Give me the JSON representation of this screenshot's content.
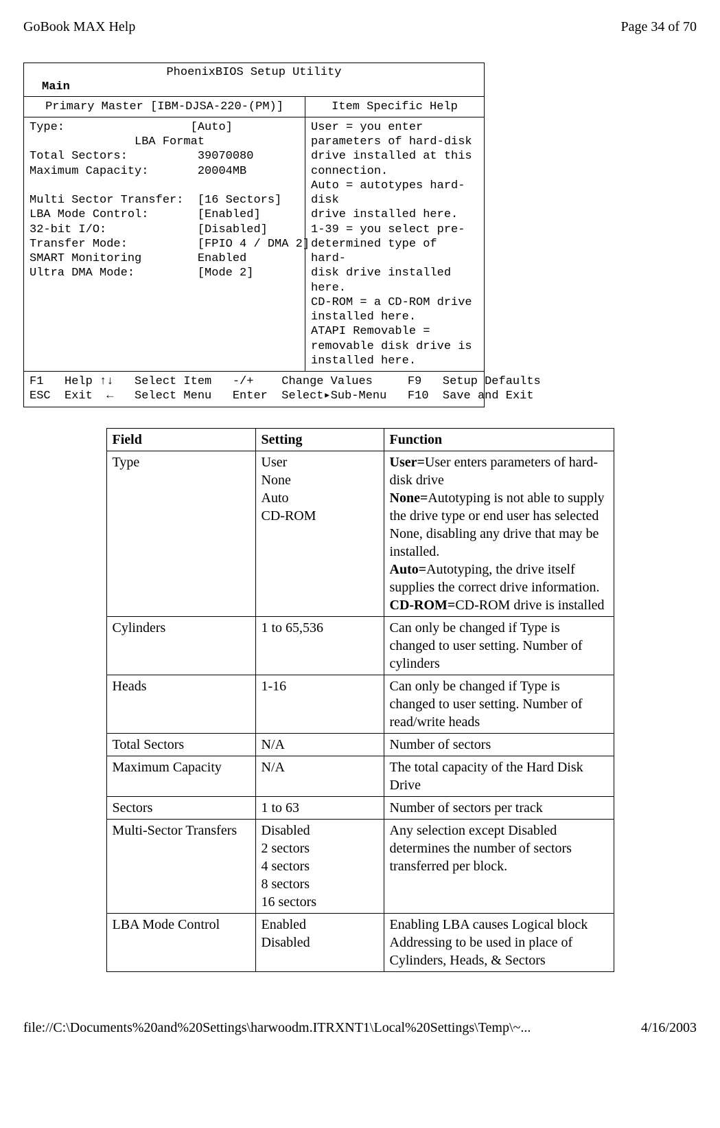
{
  "header": {
    "left": "GoBook MAX Help",
    "right": "Page 34 of 70"
  },
  "bios": {
    "title": "PhoenixBIOS Setup Utility",
    "main_label": "Main",
    "sub_left": "Primary Master [IBM-DJSA-220-(PM)]",
    "sub_right": "Item Specific Help",
    "body_left": "Type:                  [Auto]\n               LBA Format\nTotal Sectors:          39070080\nMaximum Capacity:       20004MB\n\nMulti Sector Transfer:  [16 Sectors]\nLBA Mode Control:       [Enabled]\n32-bit I/O:             [Disabled]\nTransfer Mode:          [FPIO 4 / DMA 2]\nSMART Monitoring        Enabled\nUltra DMA Mode:         [Mode 2]\n\n\n\n",
    "body_right": "User = you enter\nparameters of hard-disk\ndrive installed at this\nconnection.\nAuto = autotypes hard-disk\ndrive installed here.\n1-39 = you select pre-\ndetermined type of hard-\ndisk drive installed here.\nCD-ROM = a CD-ROM drive\ninstalled here.\nATAPI Removable =\nremovable disk drive is\ninstalled here.",
    "footer": "F1   Help ↑↓   Select Item   -/+    Change Values     F9   Setup Defaults\nESC  Exit  ←   Select Menu   Enter  Select▸Sub-Menu   F10  Save and Exit"
  },
  "table": {
    "headers": {
      "field": "Field",
      "setting": "Setting",
      "function": "Function"
    },
    "rows": [
      {
        "field": "Type",
        "setting": "User\nNone\nAuto\nCD-ROM",
        "func_parts": [
          {
            "b": "User="
          },
          {
            "t": "User enters parameters of hard-disk drive"
          },
          {
            "br": true
          },
          {
            "b": "None="
          },
          {
            "t": "Autotyping is not able to supply the drive type or end user has selected None, disabling any drive that may be installed."
          },
          {
            "br": true
          },
          {
            "b": "Auto="
          },
          {
            "t": "Autotyping, the drive itself supplies the correct drive information."
          },
          {
            "br": true
          },
          {
            "b": "CD-ROM="
          },
          {
            "t": "CD-ROM drive is installed"
          }
        ]
      },
      {
        "field": "Cylinders",
        "setting": "1 to 65,536",
        "function": "Can only be changed if Type is changed to user setting.  Number of cylinders"
      },
      {
        "field": "Heads",
        "setting": "1-16",
        "function": "Can only be changed if Type is changed to user setting. Number of read/write heads"
      },
      {
        "field": "Total Sectors",
        "setting": "N/A",
        "function": "Number of sectors"
      },
      {
        "field": "Maximum Capacity",
        "setting": "N/A",
        "function": "The total capacity of the Hard Disk Drive"
      },
      {
        "field": "Sectors",
        "setting": "1 to 63",
        "function": " Number of sectors per track"
      },
      {
        "field": "Multi-Sector Transfers",
        "setting": "Disabled\n2 sectors\n4 sectors\n8 sectors\n16 sectors",
        "function": "Any selection except Disabled determines the number of sectors transferred per block."
      },
      {
        "field": "LBA Mode Control",
        "setting": "Enabled\nDisabled",
        "function": "Enabling LBA causes Logical block Addressing to be used in place of Cylinders, Heads, & Sectors"
      }
    ]
  },
  "footer": {
    "left": "file://C:\\Documents%20and%20Settings\\harwoodm.ITRXNT1\\Local%20Settings\\Temp\\~...",
    "right": "4/16/2003"
  }
}
